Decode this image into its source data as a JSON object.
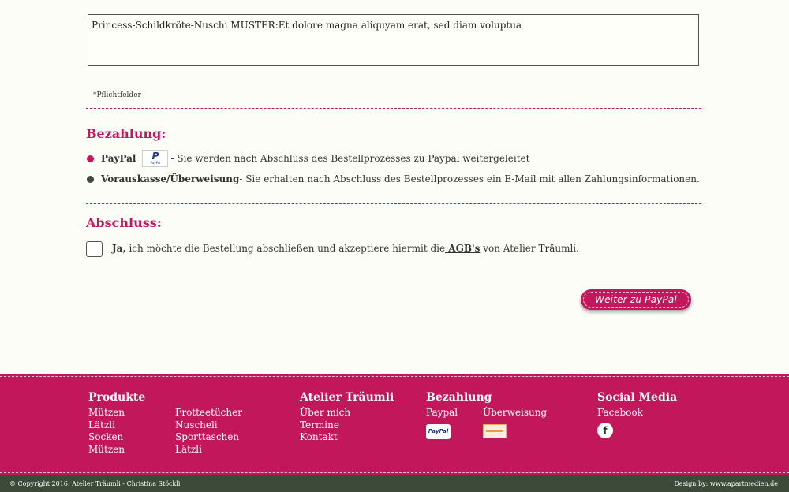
{
  "form": {
    "message_value": "Princess-Schildkröte-Nuschi MUSTER:Et dolore magna aliquyam erat, sed diam voluptua",
    "required_note": "*Pflichtfelder"
  },
  "payment": {
    "title": "Bezahlung:",
    "options": [
      {
        "name": "PayPal",
        "logo_text": "P",
        "logo_sub": "PayPal",
        "description": " - Sie werden nach Abschluss des Bestellprozesses zu Paypal weitergeleitet",
        "bullet_color": "#c2185b"
      },
      {
        "name": "Vorauskasse/Überweisung",
        "description": " - Sie erhalten nach Abschluss des Bestellprozesses ein E-Mail mit allen Zahlungsinformationen.",
        "bullet_color": "#3d4a3a"
      }
    ]
  },
  "checkout": {
    "title": "Abschluss:",
    "confirm_yes": "Ja,",
    "confirm_text_before": " ich möchte die Bestellung abschließen und akzeptiere hiermit die",
    "agb_link": " AGB's",
    "confirm_text_after": " von Atelier Träumli.",
    "submit_label": "Weiter zu PayPal"
  },
  "footer": {
    "produkte": {
      "title": "Produkte",
      "links_col1": [
        "Mützen",
        "Lätzli",
        "Socken",
        "Mützen"
      ],
      "links_col2": [
        "Frotteetücher",
        "Nuscheli",
        "Sporttaschen",
        "Lätzli"
      ]
    },
    "atelier": {
      "title": "Atelier Träumli",
      "links": [
        "Über mich",
        "Termine",
        "Kontakt"
      ]
    },
    "bezahlung": {
      "title": "Bezahlung",
      "paypal_label": "Paypal",
      "paypal_logo": "PayPal",
      "transfer_label": "Überweisung"
    },
    "social": {
      "title": "Social Media",
      "facebook_label": "Facebook",
      "facebook_icon": "f"
    }
  },
  "bottom_bar": {
    "copyright": "© Copyright 2016: Atelier Träumli - Christina Stöckli",
    "design": "Design by: www.apartmedien.de"
  },
  "colors": {
    "accent": "#c2185b",
    "dark_green": "#3d4a3a",
    "background": "#fdfdf8"
  }
}
